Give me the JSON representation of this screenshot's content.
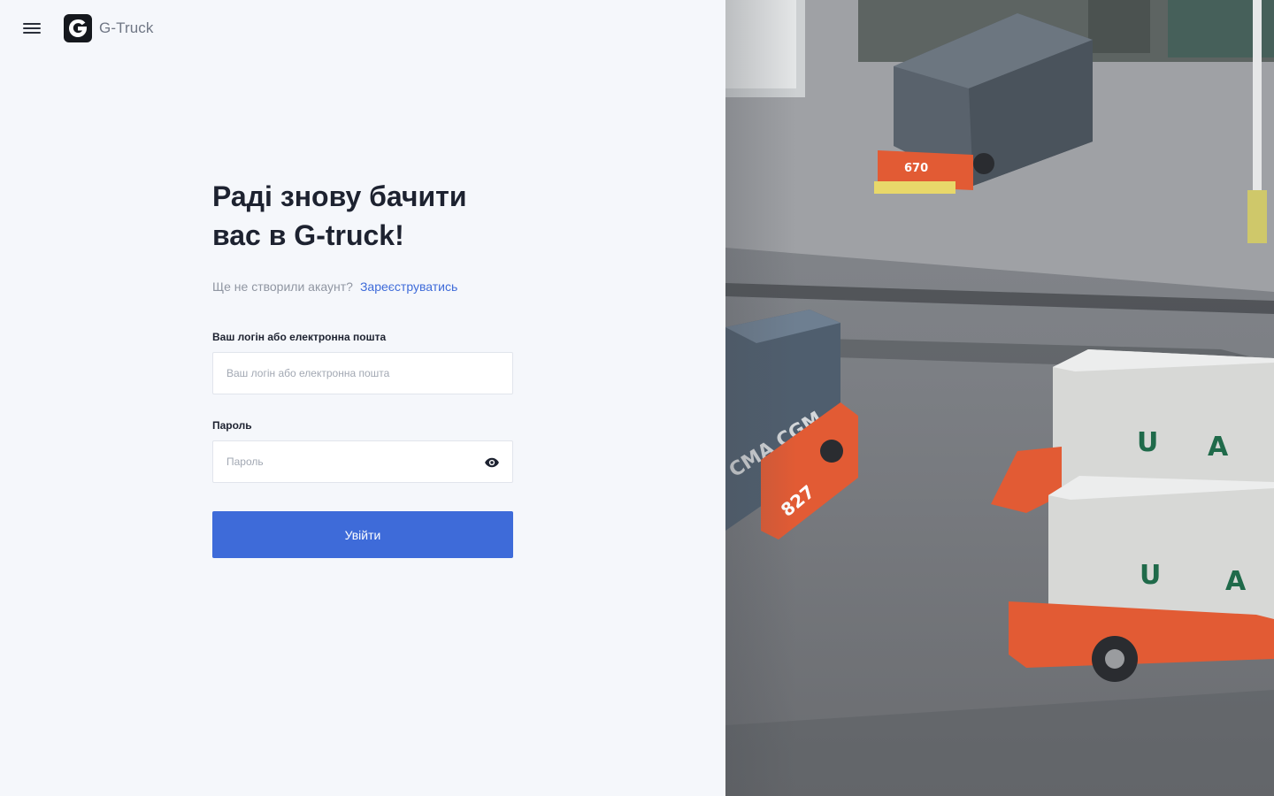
{
  "header": {
    "brand_name": "G-Truck",
    "menu_icon": "hamburger-menu-icon",
    "logo_icon": "g-truck-logo-icon"
  },
  "login": {
    "title_line1": "Раді знову бачити",
    "title_line2": "вас в G-truck!",
    "no_account_text": "Ще не створили акаунт?",
    "signup_link": "Зареєструватись",
    "login_label": "Ваш логін або електронна пошта",
    "login_placeholder": "Ваш логін або електронна пошта",
    "password_label": "Пароль",
    "password_placeholder": "Пароль",
    "password_toggle_icon": "eye-icon",
    "submit_label": "Увійти"
  },
  "hero_image": {
    "subject": "container terminal with trucks carrying shipping containers",
    "container_marks": [
      "670",
      "CMA CGM",
      "827",
      "U",
      "A",
      "U",
      "A"
    ]
  },
  "colors": {
    "accent": "#3e6bd9",
    "page_bg": "#f5f7fb",
    "title": "#1d2230"
  }
}
